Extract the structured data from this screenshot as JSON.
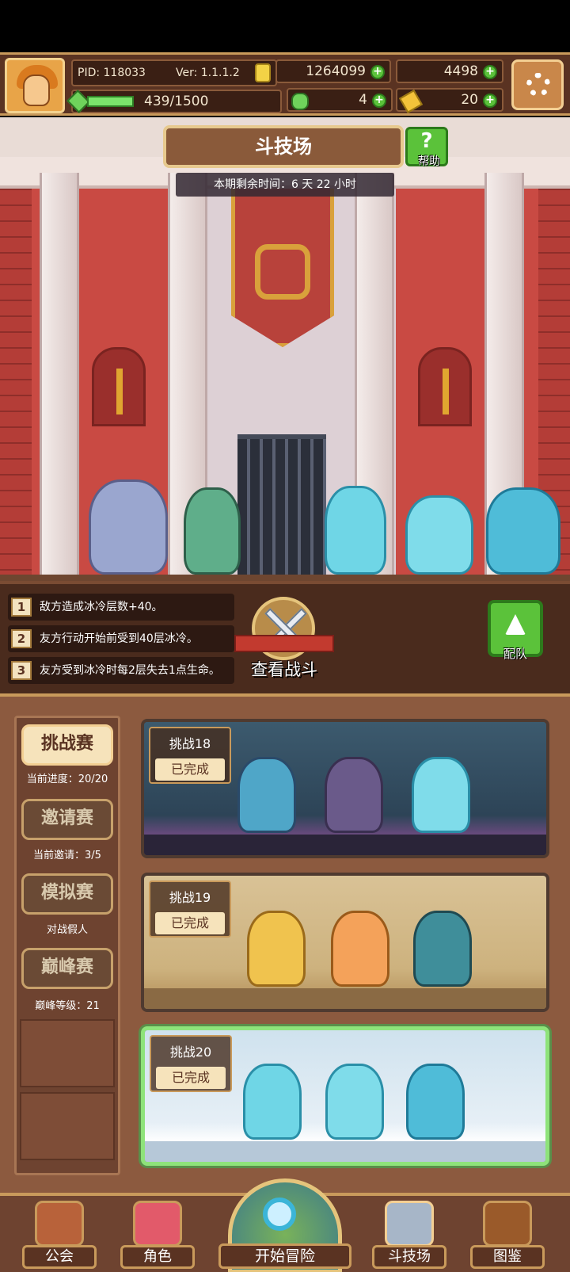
{
  "header": {
    "pid": "PID: 118033",
    "version": "Ver: 1.1.1.2",
    "gold": "1264099",
    "gems": "4498",
    "clover": "4",
    "keys": "20",
    "exp": "439/1500",
    "exp_progress": 0.293
  },
  "arena": {
    "title": "斗技场",
    "help_label": "帮助",
    "time_remaining": "本期剩余时间：6 天 22 小时"
  },
  "rules": [
    {
      "num": "1",
      "text": "敌方造成冰冷层数+40。"
    },
    {
      "num": "2",
      "text": "友方行动开始前受到40层冰冷。"
    },
    {
      "num": "3",
      "text": "友方受到冰冷时每2层失去1点生命。"
    }
  ],
  "actions": {
    "view_battle": "查看战斗",
    "team": "配队"
  },
  "modes": [
    {
      "label": "挑战赛",
      "sub": "当前进度：20/20",
      "active": true
    },
    {
      "label": "邀请赛",
      "sub": "当前邀请：3/5",
      "active": false
    },
    {
      "label": "模拟赛",
      "sub": "对战假人",
      "active": false
    },
    {
      "label": "巅峰赛",
      "sub": "巅峰等级：21",
      "active": false
    }
  ],
  "challenges": [
    {
      "name": "挑战18",
      "status": "已完成"
    },
    {
      "name": "挑战19",
      "status": "已完成"
    },
    {
      "name": "挑战20",
      "status": "已完成"
    }
  ],
  "nav": {
    "guild": "公会",
    "characters": "角色",
    "adventure": "开始冒险",
    "arena": "斗技场",
    "codex": "图鉴"
  },
  "colors": {
    "accent_green": "#5bc23a",
    "frame_gold": "#c99a5b",
    "panel_brown": "#8c5a3f"
  }
}
